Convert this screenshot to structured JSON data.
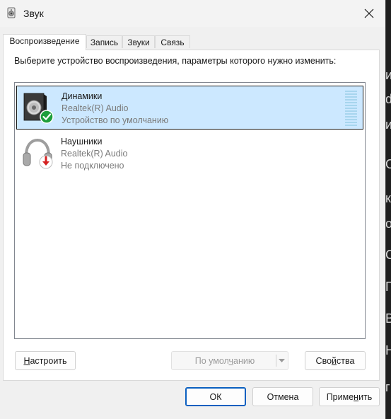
{
  "window": {
    "title": "Звук",
    "close_icon": "close-icon",
    "app_icon": "speaker-icon"
  },
  "tabs": [
    {
      "label": "Воспроизведение",
      "active": true
    },
    {
      "label": "Запись",
      "active": false
    },
    {
      "label": "Звуки",
      "active": false
    },
    {
      "label": "Связь",
      "active": false
    }
  ],
  "instruction": "Выберите устройство воспроизведения, параметры которого нужно изменить:",
  "devices": [
    {
      "name": "Динамики",
      "driver": "Realtek(R) Audio",
      "status": "Устройство по умолчанию",
      "icon": "speaker-icon",
      "badge": "check-badge",
      "selected": true
    },
    {
      "name": "Наушники",
      "driver": "Realtek(R) Audio",
      "status": "Не подключено",
      "icon": "headphones-icon",
      "badge": "disconnected-badge",
      "selected": false
    }
  ],
  "panel_buttons": {
    "configure": "Настроить",
    "configure_mnemonic": "Н",
    "configure_rest": "астроить",
    "default_pre": "По умол",
    "default_mnemonic": "ч",
    "default_post": "анию",
    "properties_pre": "Сво",
    "properties_mnemonic": "й",
    "properties_post": "ства"
  },
  "footer": {
    "ok": "ОК",
    "cancel": "Отмена",
    "apply_pre": "Приме",
    "apply_mnemonic": "н",
    "apply_post": "ить"
  },
  "background_fragments": [
    "и",
    "d",
    "и",
    "О",
    "к",
    "о",
    "С",
    "П",
    "В",
    "Н",
    "г"
  ],
  "colors": {
    "selection": "#cce8ff",
    "primary_border": "#0a60c0",
    "badge_ok": "#1e9e3a",
    "badge_error": "#d42020"
  }
}
